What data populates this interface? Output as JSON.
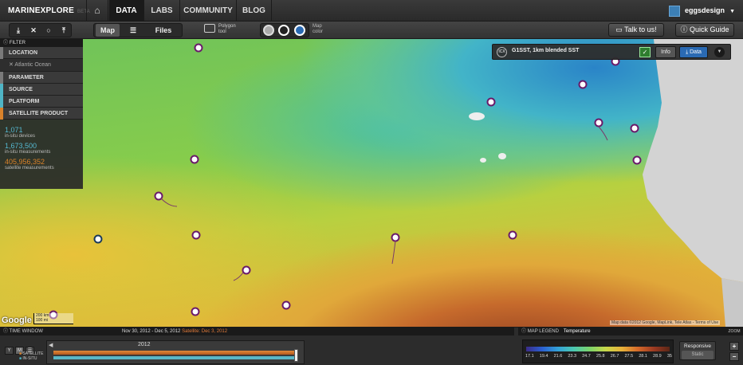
{
  "app": {
    "logo": "MARINEXPLORE",
    "logo_sub": "BETA"
  },
  "nav": {
    "home_icon": "home-icon",
    "tabs": [
      {
        "label": "DATA",
        "active": true
      },
      {
        "label": "LABS",
        "active": false
      },
      {
        "label": "COMMUNITY",
        "active": false
      },
      {
        "label": "BLOG",
        "active": false
      }
    ],
    "user": {
      "name": "eggsdesign"
    }
  },
  "toolbar": {
    "view_tabs": [
      {
        "label": "Map",
        "active": true
      },
      {
        "label": "Files",
        "active": false
      }
    ],
    "polygon_label_1": "Polygon",
    "polygon_label_2": "tool",
    "mapcolor_label_1": "Map",
    "mapcolor_label_2": "color",
    "talk_label": "Talk to us!",
    "guide_label": "Quick Guide",
    "colors": {
      "accent": "#2a6ab3",
      "nav_bg": "#2a2a2a"
    }
  },
  "filter": {
    "header": "FILTER",
    "location_label": "LOCATION",
    "location_value": "✕ Atlantic Ocean",
    "rows": [
      {
        "label": "PARAMETER",
        "color": "#7a7a7a"
      },
      {
        "label": "SOURCE",
        "color": "#4fb5c6"
      },
      {
        "label": "PLATFORM",
        "color": "#4fb5c6"
      },
      {
        "label": "SATELLITE PRODUCT",
        "color": "#d9822b"
      }
    ],
    "stats": [
      {
        "num": "1,071",
        "label": "in-situ devices",
        "color": "#55b8d0"
      },
      {
        "num": "1,673,500",
        "label": "in-situ measurements",
        "color": "#55b8d0"
      },
      {
        "num": "405,956,352",
        "label": "satellite measurements",
        "color": "#d9822b"
      }
    ]
  },
  "layer": {
    "icon_text": "ICX",
    "name": "G1SST, 1km blended SST",
    "info_label": "Info",
    "data_label": "Data"
  },
  "map": {
    "google_label": "Google",
    "scale_top": "200 km",
    "scale_bottom": "100 mi",
    "attribution": "Map data ©2012 Google, MapLink, Tele Atlas - Terms of Use"
  },
  "time_window": {
    "header": "TIME WINDOW",
    "range": "Nov 30, 2012 - Dec 5, 2012",
    "satellite": "Satellite: Dec 3, 2012",
    "year": "2012",
    "y_btn": "Y",
    "m_btn": "M",
    "sat_label_1": "SATELLITE",
    "sat_label_2": "IN-SITU"
  },
  "legend": {
    "header": "MAP LEGEND",
    "title": "Temperature",
    "values": [
      "17.1",
      "19.4",
      "21.6",
      "23.3",
      "24.7",
      "25.8",
      "26.7",
      "27.5",
      "28.1",
      "28.9",
      "35"
    ],
    "responsive": "Responsive",
    "static": "Static"
  },
  "zoom": {
    "header": "ZOOM",
    "plus": "+",
    "minus": "−"
  }
}
